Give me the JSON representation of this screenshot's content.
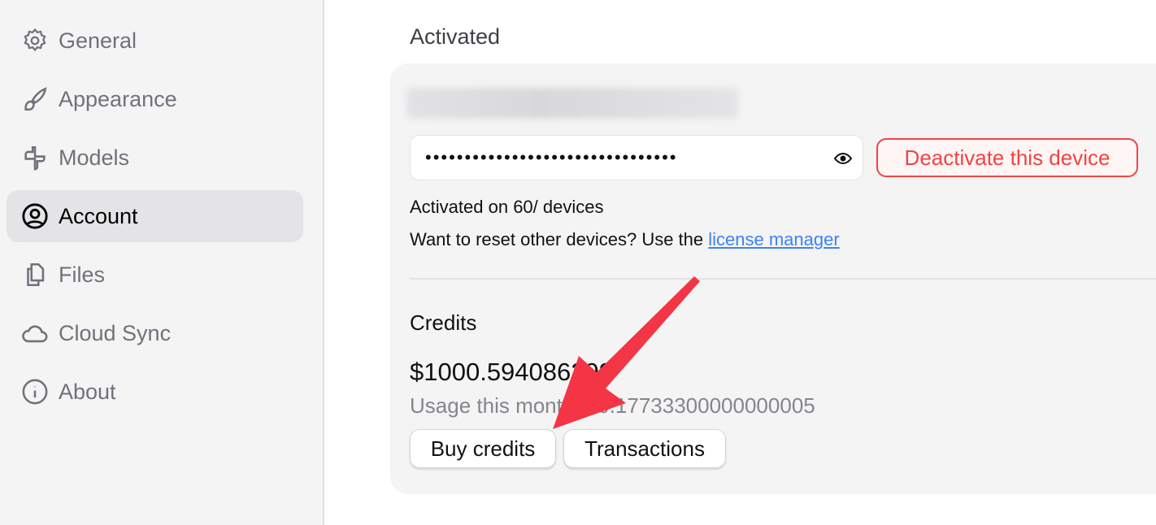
{
  "sidebar": {
    "items": [
      {
        "label": "General",
        "icon": "gear-icon"
      },
      {
        "label": "Appearance",
        "icon": "brush-icon"
      },
      {
        "label": "Models",
        "icon": "models-icon"
      },
      {
        "label": "Account",
        "icon": "user-circle-icon",
        "active": true
      },
      {
        "label": "Files",
        "icon": "files-icon"
      },
      {
        "label": "Cloud Sync",
        "icon": "cloud-icon"
      },
      {
        "label": "About",
        "icon": "info-icon"
      }
    ]
  },
  "main": {
    "heading": "Activated",
    "license_key_masked": "••••••••••••••••••••••••••••••••",
    "deactivate_label": "Deactivate this device",
    "activated_on": "Activated on 60/ devices",
    "reset_text": "Want to reset other devices? Use the ",
    "license_manager_link": "license manager",
    "credits_title": "Credits",
    "credits_value": "$1000.594086299",
    "usage": "Usage this month: $0.17733300000000005",
    "buy_label": "Buy credits",
    "transactions_label": "Transactions"
  },
  "colors": {
    "danger": "#ef4444",
    "link": "#3b82f6",
    "arrow": "#f43545"
  }
}
